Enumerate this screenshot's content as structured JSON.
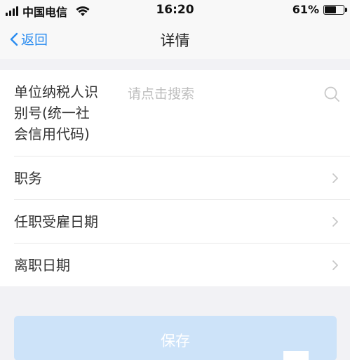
{
  "status_bar": {
    "carrier": "中国电信",
    "time": "16:20",
    "battery_percent": "61%",
    "battery_level": 0.61
  },
  "nav": {
    "back_label": "返回",
    "title": "详情"
  },
  "form": {
    "tax_id": {
      "label_line1": "单位纳税人识",
      "label_line2": "别号(统一社",
      "label_line3": "会信用代码)",
      "placeholder": "请点击搜索"
    },
    "rows": [
      {
        "label": "职务"
      },
      {
        "label": "任职受雇日期"
      },
      {
        "label": "离职日期"
      }
    ]
  },
  "save_label": "保存",
  "colors": {
    "accent": "#2a8cf0",
    "save_button_bg": "#cde3f9",
    "page_bg": "#f2f2f5"
  }
}
